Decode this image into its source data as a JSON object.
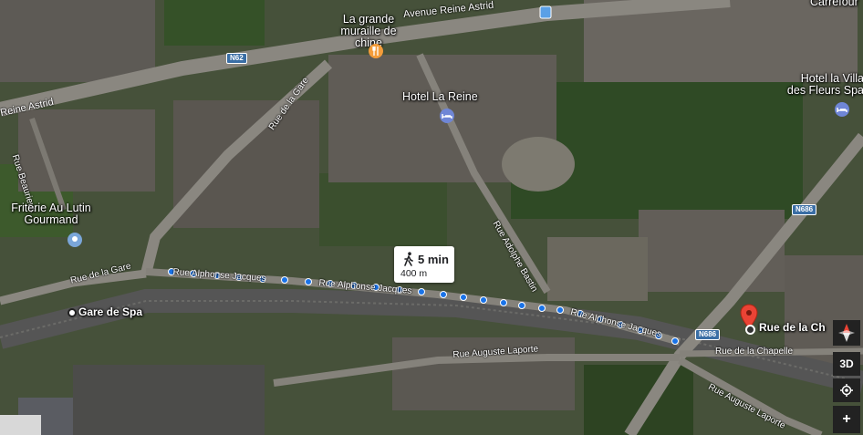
{
  "pois": {
    "great_wall": "La grande muraille de chine",
    "hotel_reine": "Hotel La Reine",
    "hotel_villa": "Hotel la Villa des Fleurs Spa",
    "friterie": "Friterie Au Lutin Gourmand",
    "gare": "Gare de Spa",
    "rue_chapelle_dest": "Rue de la Ch",
    "carrefour": "Carrefour"
  },
  "streets": {
    "avenue_reine": "Avenue Reine Astrid",
    "reine_astrid": "Reine Astrid",
    "beaurieux": "Rue Beaurieux",
    "de_la_gare_top": "Rue de la Gare",
    "de_la_gare_left": "Rue de la Gare",
    "alphonse_1": "Rue Alphonse Jacques",
    "alphonse_2": "Rue Alphonse Jacques",
    "alphonse_3": "Rue Alphonse Jacques",
    "adolphe": "Rue Adolphe Bastin",
    "auguste_1": "Rue Auguste Laporte",
    "auguste_2": "Rue Auguste Laporte",
    "chapelle": "Rue de la Chapelle"
  },
  "shields": {
    "n62": "N62",
    "n686_a": "N686",
    "n686_b": "N686"
  },
  "route": {
    "duration": "5 min",
    "distance": "400 m"
  },
  "controls": {
    "mode_3d": "3D",
    "zoom_in": "+"
  },
  "icons": {
    "restaurant": "fork-knife-icon",
    "hotel": "bed-icon",
    "pin": "location-pin-icon",
    "walk": "walking-person-icon",
    "compass": "compass-icon",
    "locate": "my-location-icon"
  },
  "colors": {
    "route_dot": "#1a73e8",
    "pin_red": "#ea4335",
    "poi_orange": "#f39c3a",
    "hotel_blue": "#6f86d6"
  }
}
